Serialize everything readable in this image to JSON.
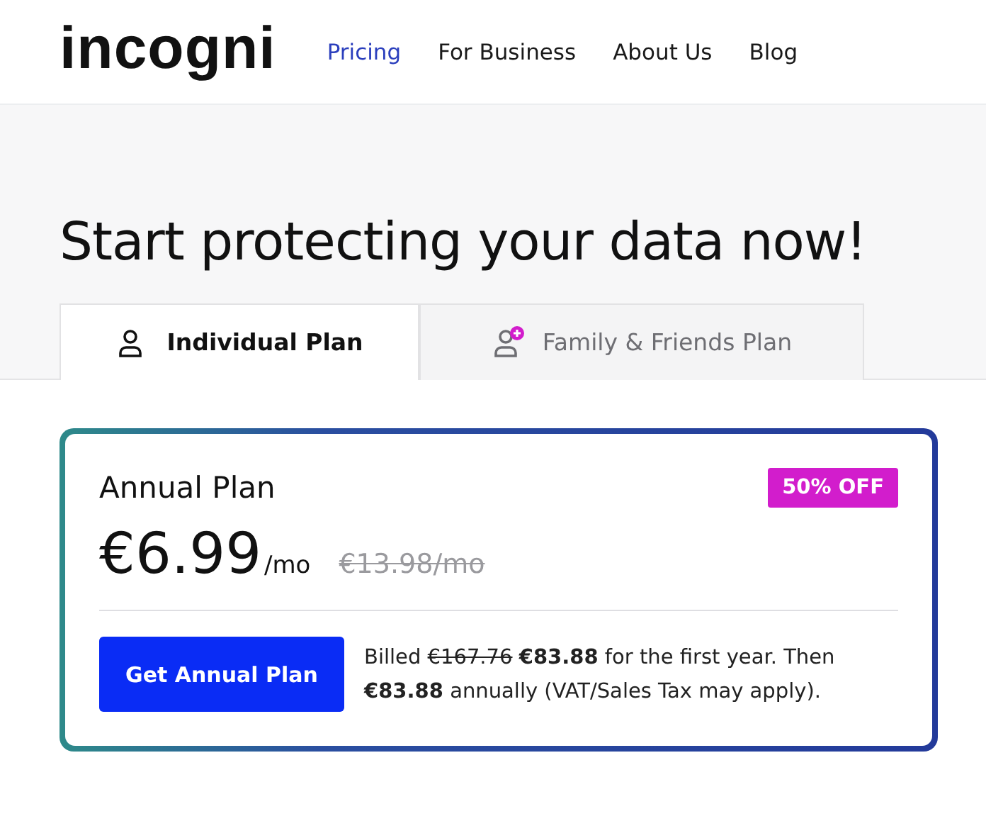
{
  "logo": "incogni",
  "nav": [
    {
      "label": "Pricing",
      "selected": true
    },
    {
      "label": "For Business",
      "selected": false
    },
    {
      "label": "About Us",
      "selected": false
    },
    {
      "label": "Blog",
      "selected": false
    }
  ],
  "heading": "Start protecting your data now!",
  "tabs": [
    {
      "label": "Individual Plan",
      "kind": "single",
      "selected": true
    },
    {
      "label": "Family & Friends Plan",
      "kind": "group",
      "selected": false
    }
  ],
  "plan": {
    "title": "Annual Plan",
    "badge": "50% OFF",
    "price": "€6.99",
    "unit": "/mo",
    "old_price": "€13.98/mo",
    "button": "Get Annual Plan",
    "billing": {
      "prefix": "Billed",
      "old": "€167.76",
      "rest": "**€83.88** for the first year. Then **€83.88** annually (VAT/Sales Tax may apply)."
    }
  }
}
